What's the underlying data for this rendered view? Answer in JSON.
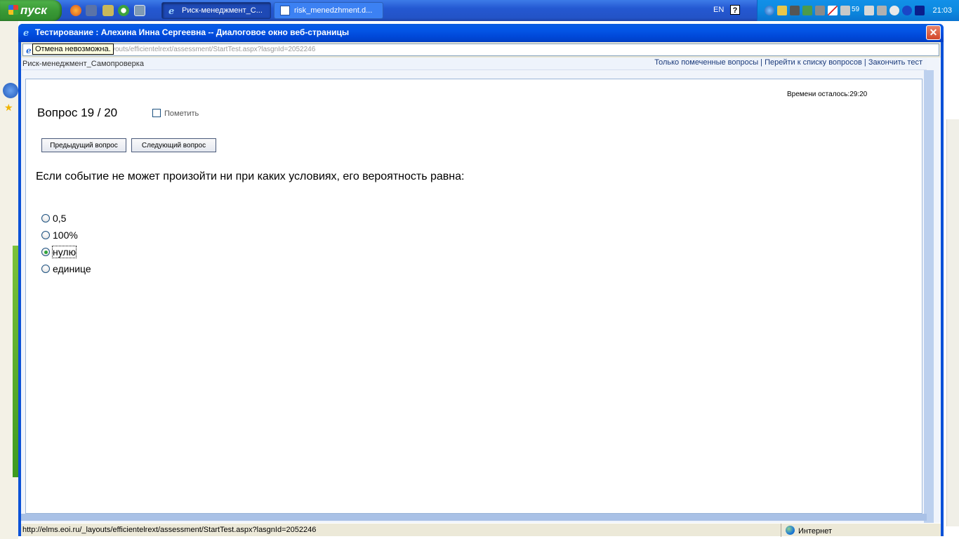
{
  "taskbar": {
    "start_label": "пуск",
    "tasks": [
      {
        "label": "Риск-менеджмент_С...",
        "active": true
      },
      {
        "label": "risk_menedzhment.d...",
        "active": false
      }
    ],
    "lang": "EN",
    "help": "?",
    "tray_number": "59",
    "clock": "21:03"
  },
  "dialog": {
    "title": "Тестирование : Алехина Инна Сергеевна -- Диалоговое окно веб-страницы",
    "close": "✕",
    "address_visible": "youts/efficientelrext/assessment/StartTest.aspx?lasgnId=2052246",
    "tooltip": "Отмена невозможна."
  },
  "topnav": {
    "crumb": "Риск-менеджмент_Самопроверка",
    "link_marked": "Только помеченные вопросы",
    "separator": " | ",
    "link_list": "Перейти к списку вопросов",
    "link_finish": "Закончить тест"
  },
  "quiz": {
    "timer": "Времени осталось:29:20",
    "question_title": "Вопрос 19 / 20",
    "mark_label": "Пометить",
    "prev_button": "Предыдущий вопрос",
    "next_button": "Следующий вопрос",
    "question_text": "Если событие не может произойти ни при каких условиях, его вероятность равна:",
    "options": [
      {
        "label": "0,5",
        "selected": false
      },
      {
        "label": "100%",
        "selected": false
      },
      {
        "label": "нулю",
        "selected": true
      },
      {
        "label": "единице",
        "selected": false
      }
    ]
  },
  "statusbar": {
    "url": "http://elms.eoi.ru/_layouts/efficientelrext/assessment/StartTest.aspx?lasgnId=2052246",
    "zone": "Интернет"
  },
  "colors": {
    "taskbar": "#2458d1",
    "titlebar": "#0457e8",
    "selected_radio": "#2fa43a"
  }
}
